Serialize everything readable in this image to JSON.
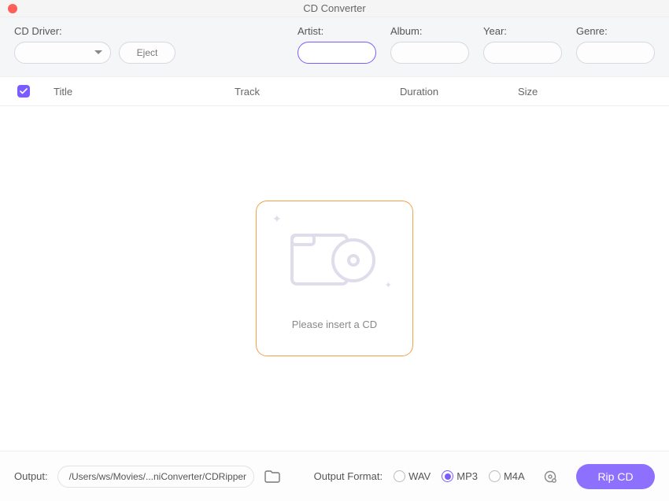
{
  "window": {
    "title": "CD Converter"
  },
  "toolbar": {
    "cd_driver_label": "CD Driver:",
    "eject_label": "Eject",
    "artist_label": "Artist:",
    "album_label": "Album:",
    "year_label": "Year:",
    "genre_label": "Genre:",
    "artist_value": "",
    "album_value": "",
    "year_value": "",
    "genre_value": ""
  },
  "table": {
    "col_title": "Title",
    "col_track": "Track",
    "col_duration": "Duration",
    "col_size": "Size"
  },
  "empty_state": {
    "prompt": "Please insert a CD"
  },
  "footer": {
    "output_label": "Output:",
    "output_path": "/Users/ws/Movies/...niConverter/CDRipper",
    "format_label": "Output Format:",
    "formats": {
      "wav": "WAV",
      "mp3": "MP3",
      "m4a": "M4A"
    },
    "selected_format": "MP3",
    "rip_label": "Rip CD"
  }
}
